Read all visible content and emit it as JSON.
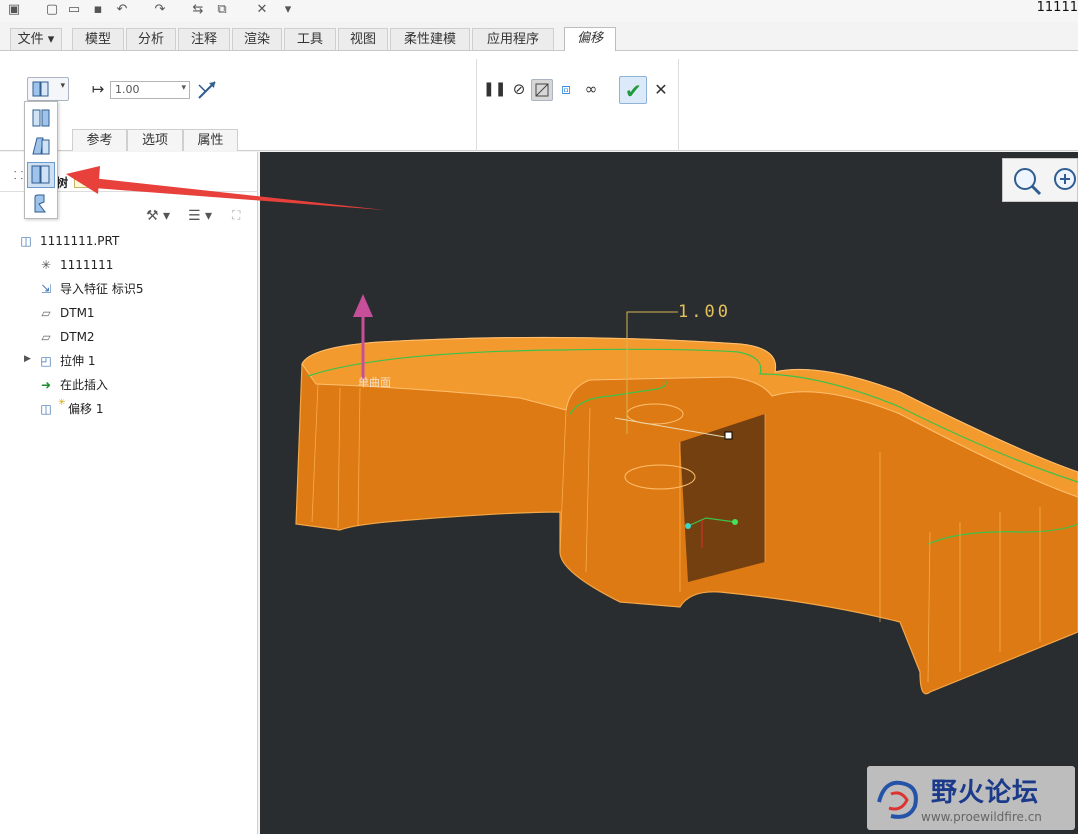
{
  "window": {
    "title_fragment": "11111"
  },
  "ribbon": {
    "tabs": [
      "文件",
      "模型",
      "分析",
      "注释",
      "渲染",
      "工具",
      "视图",
      "柔性建模",
      "应用程序",
      "偏移"
    ],
    "active_tab": "偏移",
    "offset_value": "1.00",
    "sub_tabs": [
      "参考",
      "选项",
      "属性"
    ]
  },
  "tree": {
    "label": "树",
    "items": [
      {
        "label": "1111111.PRT",
        "icon": "part-icon"
      },
      {
        "label": "1111111",
        "icon": "csys-icon"
      },
      {
        "label": "导入特征 标识5",
        "icon": "import-feature-icon"
      },
      {
        "label": "DTM1",
        "icon": "datum-plane-icon"
      },
      {
        "label": "DTM2",
        "icon": "datum-plane-icon"
      },
      {
        "label": "拉伸 1",
        "icon": "extrude-icon"
      },
      {
        "label": "在此插入",
        "icon": "insert-here-icon"
      },
      {
        "label": "偏移 1",
        "icon": "offset-icon"
      }
    ]
  },
  "viewport": {
    "dimension_label": "1.00",
    "surface_label": "单曲面",
    "background": "#2a2d2f",
    "model_color": "#f08a10"
  },
  "watermark": {
    "title": "野火论坛",
    "url": "www.proewildfire.cn"
  },
  "colors": {
    "accent": "#3a6fb0",
    "arrow": "#e8403a",
    "confirm": "#1e9a3a"
  }
}
